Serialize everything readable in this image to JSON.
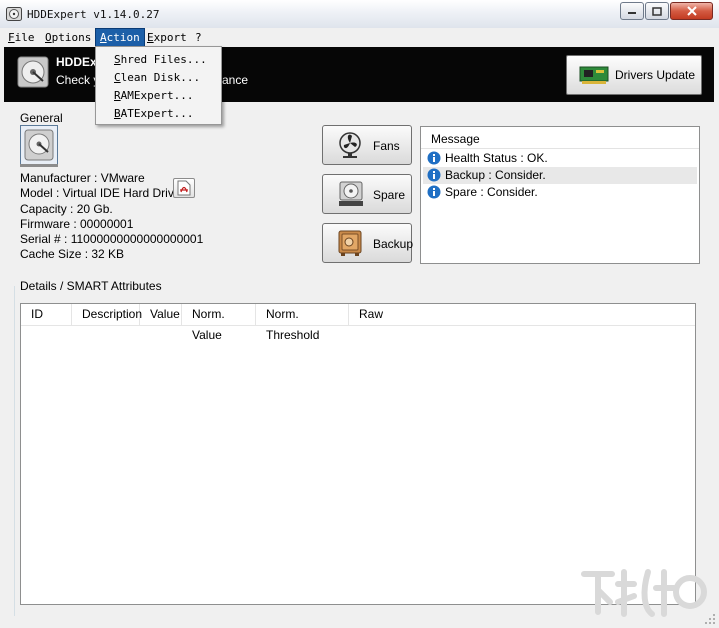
{
  "window": {
    "title": "HDDExpert v1.14.0.27"
  },
  "menu": {
    "items": [
      "File",
      "Options",
      "Action",
      "Export",
      "?"
    ],
    "active": "Action",
    "action_dropdown": [
      "Shred Files...",
      "Clean Disk...",
      "RAMExpert...",
      "BATExpert..."
    ]
  },
  "banner": {
    "title": "HDDEx",
    "subtitle_left": "Check y",
    "subtitle_right": "ance",
    "drivers_update_label": "Drivers Update"
  },
  "general": {
    "label": "General",
    "manufacturer": "Manufacturer : VMware",
    "model": "Model : Virtual IDE Hard Drive",
    "capacity": "Capacity : 20 Gb.",
    "firmware": "Firmware : 00000001",
    "serial": "Serial # : 11000000000000000001",
    "cache": "Cache Size : 32 KB"
  },
  "buttons": {
    "fans": "Fans",
    "spare": "Spare",
    "backup": "Backup"
  },
  "messages": {
    "header": "Message",
    "rows": [
      {
        "text": "Health Status : OK.",
        "highlighted": false
      },
      {
        "text": "Backup : Consider.",
        "highlighted": true
      },
      {
        "text": "Spare : Consider.",
        "highlighted": false
      }
    ]
  },
  "details": {
    "label": "Details / SMART Attributes",
    "columns": [
      "ID",
      "Description",
      "Value",
      "Norm. Value",
      "Norm. Threshold",
      "Raw"
    ]
  },
  "colors": {
    "menu_highlight": "#1c5fa8",
    "banner_bg": "#060606",
    "info_icon": "#1f6fc4"
  }
}
